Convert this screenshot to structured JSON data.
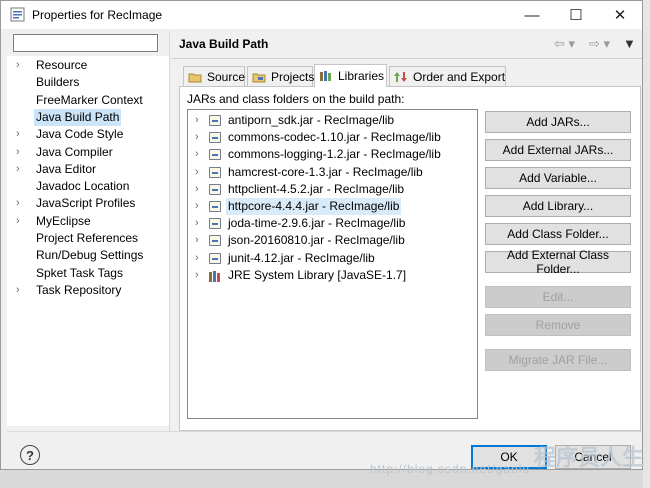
{
  "window": {
    "title": "Properties for RecImage",
    "minimize_glyph": "—",
    "maximize_glyph": "☐",
    "close_glyph": "✕"
  },
  "filter": {
    "value": "",
    "placeholder": ""
  },
  "nav": {
    "items": [
      {
        "label": "Resource",
        "expandable": true
      },
      {
        "label": "Builders",
        "expandable": false
      },
      {
        "label": "FreeMarker Context",
        "expandable": false
      },
      {
        "label": "Java Build Path",
        "expandable": false,
        "selected": true
      },
      {
        "label": "Java Code Style",
        "expandable": true
      },
      {
        "label": "Java Compiler",
        "expandable": true
      },
      {
        "label": "Java Editor",
        "expandable": true
      },
      {
        "label": "Javadoc Location",
        "expandable": false
      },
      {
        "label": "JavaScript Profiles",
        "expandable": true
      },
      {
        "label": "MyEclipse",
        "expandable": true
      },
      {
        "label": "Project References",
        "expandable": false
      },
      {
        "label": "Run/Debug Settings",
        "expandable": false
      },
      {
        "label": "Spket Task Tags",
        "expandable": false
      },
      {
        "label": "Task Repository",
        "expandable": true
      }
    ]
  },
  "page": {
    "title": "Java Build Path"
  },
  "tabs": [
    {
      "label": "Source",
      "icon": "source-folder-icon"
    },
    {
      "label": "Projects",
      "icon": "projects-icon"
    },
    {
      "label": "Libraries",
      "icon": "libraries-icon",
      "active": true
    },
    {
      "label": "Order and Export",
      "icon": "order-export-icon"
    }
  ],
  "libraries": {
    "caption": "JARs and class folders on the build path:",
    "entries": [
      {
        "label": "antiporn_sdk.jar - RecImage/lib"
      },
      {
        "label": "commons-codec-1.10.jar - RecImage/lib"
      },
      {
        "label": "commons-logging-1.2.jar - RecImage/lib"
      },
      {
        "label": "hamcrest-core-1.3.jar - RecImage/lib"
      },
      {
        "label": "httpclient-4.5.2.jar - RecImage/lib"
      },
      {
        "label": "httpcore-4.4.4.jar - RecImage/lib",
        "selected": true
      },
      {
        "label": "joda-time-2.9.6.jar - RecImage/lib"
      },
      {
        "label": "json-20160810.jar - RecImage/lib"
      },
      {
        "label": "junit-4.12.jar - RecImage/lib"
      },
      {
        "label": "JRE System Library [JavaSE-1.7]",
        "type": "library"
      }
    ]
  },
  "buttons": {
    "add_jars": "Add JARs...",
    "add_external_jars": "Add External JARs...",
    "add_variable": "Add Variable...",
    "add_library": "Add Library...",
    "add_class_folder": "Add Class Folder...",
    "add_external_class_folder": "Add External Class Folder...",
    "edit": "Edit...",
    "remove": "Remove",
    "migrate_jar": "Migrate JAR File..."
  },
  "dialog": {
    "help_glyph": "?",
    "ok": "OK",
    "cancel": "Cancel"
  },
  "watermark": {
    "url": "http://blog.csdn.net/gaolu",
    "site": "程序员人生"
  },
  "colors": {
    "selection": "#cce4f7",
    "accent": "#0078d7"
  }
}
